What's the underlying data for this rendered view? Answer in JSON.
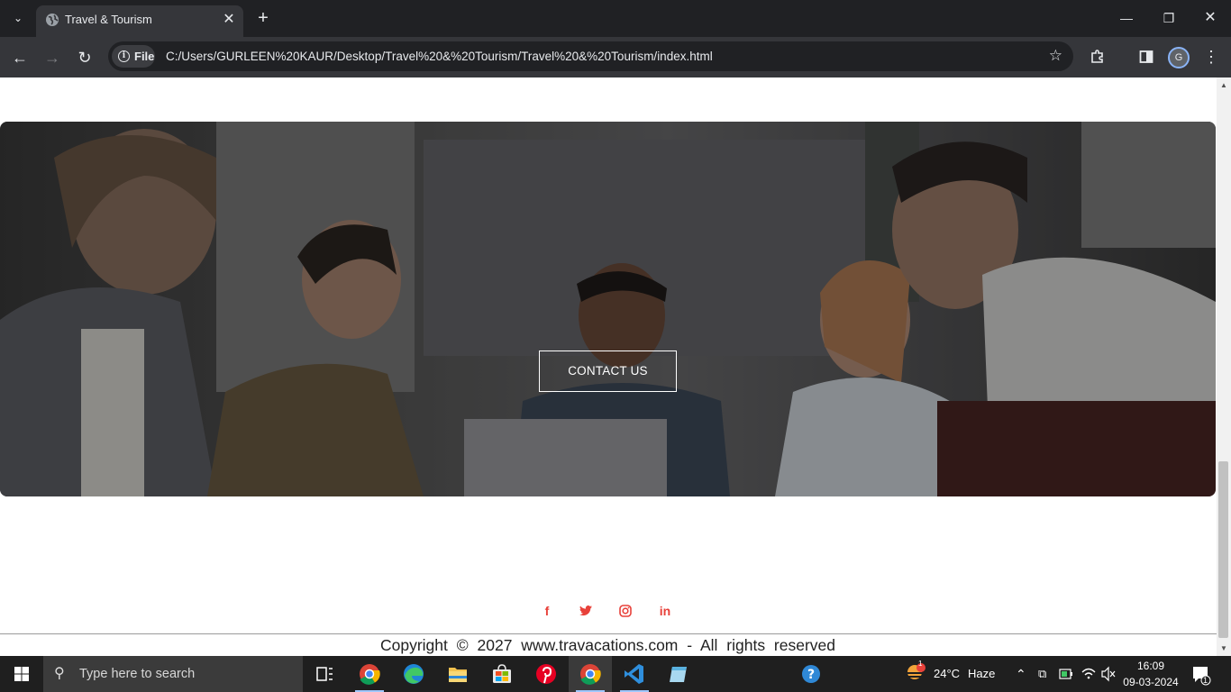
{
  "browser": {
    "tab_title": "Travel & Tourism",
    "new_tab_symbol": "+",
    "site_chip_label": "File",
    "url": "C:/Users/GURLEEN%20KAUR/Desktop/Travel%20&%20Tourism/Travel%20&%20Tourism/index.html",
    "profile_initial": "G"
  },
  "page": {
    "contact_button": "CONTACT US",
    "socials": [
      "facebook-icon",
      "twitter-icon",
      "instagram-icon",
      "linkedin-icon"
    ],
    "social_glyphs": [
      "f",
      "t",
      "◎",
      "in"
    ],
    "accent_color": "#e8413a",
    "copyright": "Copyright © 2027 www.travacations.com - All rights reserved"
  },
  "taskbar": {
    "search_placeholder": "Type here to search",
    "weather_temp": "24°C",
    "weather_desc": "Haze",
    "weather_badge": "1",
    "time": "16:09",
    "date": "09-03-2024",
    "notification_count": "1",
    "apps": [
      "task-view-icon",
      "chrome-icon",
      "edge-icon",
      "file-explorer-icon",
      "microsoft-store-icon",
      "pinterest-icon",
      "chrome-icon",
      "vscode-icon",
      "notepad-icon",
      "help-icon"
    ]
  }
}
